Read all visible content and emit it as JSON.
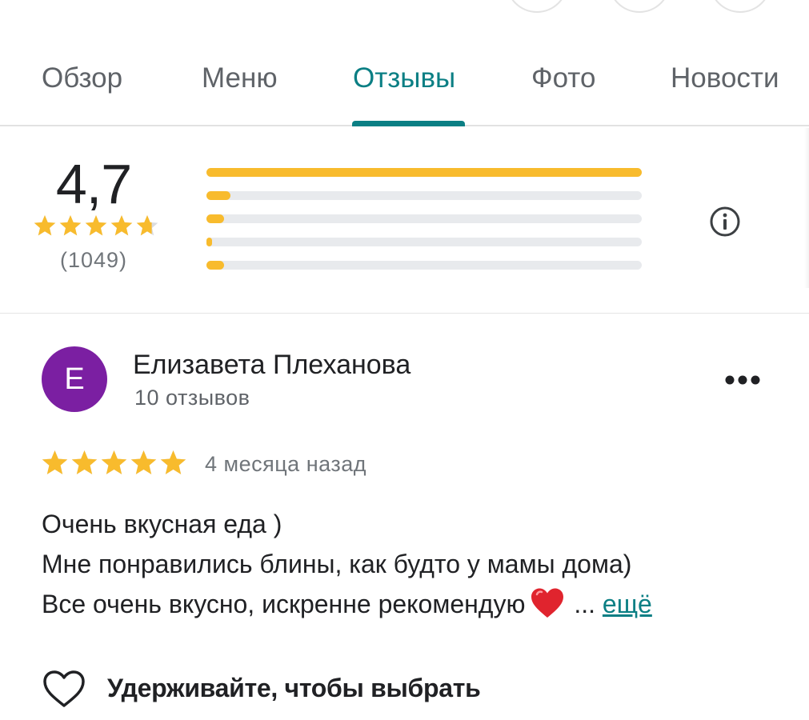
{
  "tabs": [
    {
      "label": "Обзор"
    },
    {
      "label": "Меню"
    },
    {
      "label": "Отзывы",
      "active": true
    },
    {
      "label": "Фото"
    },
    {
      "label": "Новости"
    }
  ],
  "summary": {
    "average": "4,7",
    "stars": 4.7,
    "count": "(1049)",
    "distribution": [
      {
        "stars": 5,
        "fraction": 1.0
      },
      {
        "stars": 4,
        "fraction": 0.055
      },
      {
        "stars": 3,
        "fraction": 0.04
      },
      {
        "stars": 2,
        "fraction": 0.012
      },
      {
        "stars": 1,
        "fraction": 0.04
      }
    ],
    "info_icon": "info-icon"
  },
  "review": {
    "avatar_letter": "Е",
    "avatar_color": "#7b1fa2",
    "author": "Елизавета Плеханова",
    "author_meta": "10 отзывов",
    "rating": 5,
    "date": "4 месяца назад",
    "text_lines": [
      "Очень вкусная еда )",
      "Мне понравились блины, как будто у мамы дома)",
      "Все очень вкусно, искренне рекомендую"
    ],
    "ellipsis": " ...",
    "more_label": "ещё",
    "like_label": "Удерживайте, чтобы выбрать"
  },
  "colors": {
    "accent": "#0b7f84",
    "star": "#f8bb2d",
    "track": "#e8eaed"
  }
}
